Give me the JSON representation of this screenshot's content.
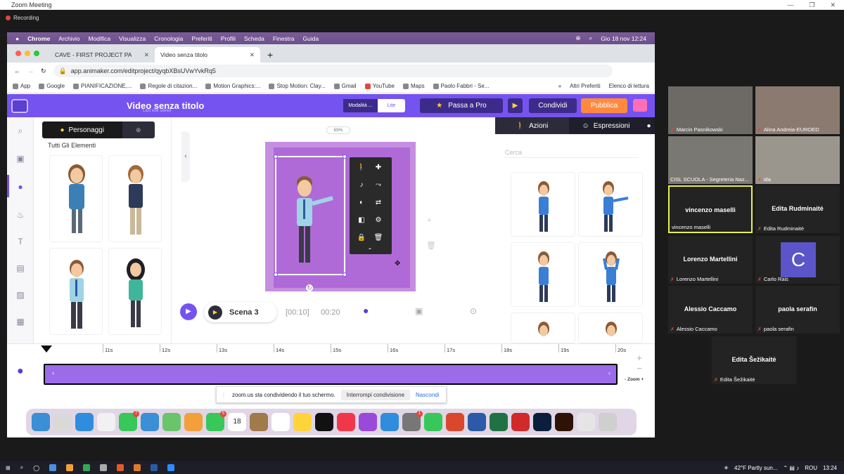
{
  "zoom": {
    "title": "Zoom Meeting",
    "recording": "Recording"
  },
  "mac_menu": {
    "app": "Chrome",
    "items": [
      "Archivio",
      "Modifica",
      "Visualizza",
      "Cronologia",
      "Preferiti",
      "Profili",
      "Scheda",
      "Finestra",
      "Guida"
    ],
    "clock": "Gio 18 nov  12:24"
  },
  "browser": {
    "tabs": [
      {
        "label": "CAVE - FIRST PROJECT PA"
      },
      {
        "label": "Video senza titolo"
      }
    ],
    "url": "app.animaker.com/editproject/qyqbXBsUVwYvkRq5",
    "bookmarks": [
      "App",
      "Google",
      "PIANIFICAZIONE,...",
      "Regole di citazion...",
      "Motion Graphics:...",
      "Stop Motion: Clay...",
      "Gmail",
      "YouTube",
      "Maps",
      "Paolo Fabbri - Se..."
    ],
    "bookmarks_more": "»",
    "bookmarks_right": [
      "Altri Preferiti",
      "Elenco di lettura"
    ]
  },
  "animaker": {
    "title": "Video senza titolo",
    "subtitle": "Last edit saved",
    "mode_label": "Modalità ...",
    "mode_value": "Lite",
    "pro_label": "Passa a Pro",
    "share_label": "Condividi",
    "publish_label": "Pubblica",
    "char_tab": "Personaggi",
    "char_section": "Tutti Gli Elementi",
    "zoom_level": "69%",
    "scene_label": "Scena 3",
    "time_current": "[00:10]",
    "time_total": "00:20",
    "right_tabs": [
      "Azioni",
      "Espressioni"
    ],
    "search_placeholder": "Cerca",
    "ruler": [
      "11s",
      "12s",
      "13s",
      "14s",
      "15s",
      "16s",
      "17s",
      "18s",
      "19s",
      "20s"
    ],
    "timeline_zoom": "- Zoom +"
  },
  "share_notice": {
    "message": "zoom.us sta condividendo il tuo schermo.",
    "stop": "Interrompi condivisione",
    "hide": "Nascondi"
  },
  "participants": [
    {
      "name": "Marcin Pasnikowski",
      "video": true
    },
    {
      "name": "Alina Andreia-EUROED",
      "video": true
    },
    {
      "name": "CISL SCUOLA - Segreteria Naz...",
      "video": true
    },
    {
      "name": "ida",
      "video": true
    },
    {
      "name": "vincenzo maselli",
      "label": "vincenzo maselli"
    },
    {
      "name": "Edita Rudminaitė",
      "label": "Edita Rudminaitė"
    },
    {
      "name": "Lorenzo Martellini",
      "label": "Lorenzo Martellini"
    },
    {
      "name": "Carlo Rais",
      "avatar": "C"
    },
    {
      "name": "Alessio Caccamo",
      "label": "Alessio Caccamo"
    },
    {
      "name": "paola serafin",
      "label": "paola serafin"
    },
    {
      "name": "Edita Šežikaitė",
      "label": "Edita Šežikaitė"
    }
  ],
  "taskbar": {
    "weather": "42°F  Partly sun...",
    "lang": "ROU",
    "time": "13:24"
  },
  "dock_badges": [
    "7",
    "5",
    "18",
    "1"
  ],
  "colors": {
    "accent": "#7553f0",
    "publish": "#ff8a3d",
    "canvas": "#c58fe0",
    "track": "#9b6bea"
  }
}
